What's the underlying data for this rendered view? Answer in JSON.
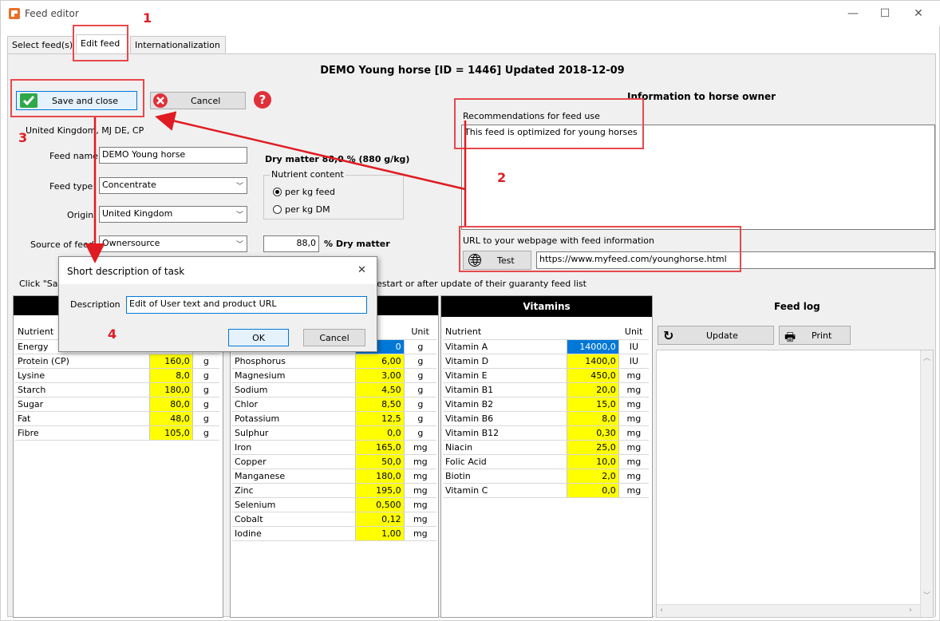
{
  "window": {
    "title": "Feed editor",
    "minimize": "—",
    "maximize": "☐",
    "close": "✕"
  },
  "tabs": [
    {
      "label": "Select feed(s)"
    },
    {
      "label": "Edit feed"
    },
    {
      "label": "Internationalization"
    }
  ],
  "header": {
    "title": "DEMO Young horse [ID = 1446] Updated 2018-12-09"
  },
  "toolbar": {
    "save_label": "Save and close",
    "cancel_label": "Cancel",
    "help_glyph": "?"
  },
  "form": {
    "region_text": "United Kingdom, MJ DE, CP",
    "feed_name_label": "Feed name",
    "feed_name_value": "DEMO Young horse",
    "feed_type_label": "Feed type",
    "feed_type_value": "Concentrate",
    "origin_label": "Origin",
    "origin_value": "United Kingdom",
    "source_label": "Source of feed",
    "source_value": "Ownersource",
    "dry_matter_heading": "Dry matter 88,0 %  (880 g/kg)",
    "nutrient_content_label": "Nutrient content",
    "per_kg_feed": "per kg feed",
    "per_kg_dm": "per kg DM",
    "dm_value": "88,0",
    "dm_unit": "% Dry matter",
    "info_prefix": "Click \"Sav",
    "info_suffix": "estart or after update of their guaranty feed list"
  },
  "owner_info": {
    "heading": "Information to horse owner",
    "recommend_label": "Recommendations for feed use",
    "recommend_text": "This feed is optimized for young horses",
    "url_label": "URL to your webpage with feed information",
    "test_label": "Test",
    "url_value": "https://www.myfeed.com/younghorse.html"
  },
  "basic": {
    "header_nutrient": "Nutrient",
    "rows": [
      {
        "n": "Energy",
        "v": "",
        "u": ""
      },
      {
        "n": "Protein (CP)",
        "v": "160,0",
        "u": "g"
      },
      {
        "n": "Lysine",
        "v": "8,0",
        "u": "g"
      },
      {
        "n": "Starch",
        "v": "180,0",
        "u": "g"
      },
      {
        "n": "Sugar",
        "v": "80,0",
        "u": "g"
      },
      {
        "n": "Fat",
        "v": "48,0",
        "u": "g"
      },
      {
        "n": "Fibre",
        "v": "105,0",
        "u": "g"
      }
    ]
  },
  "minerals": {
    "header_unit": "Unit",
    "first_unit": "g",
    "first_value": "0",
    "rows": [
      {
        "n": "Phosphorus",
        "v": "6,00",
        "u": "g"
      },
      {
        "n": "Magnesium",
        "v": "3,00",
        "u": "g"
      },
      {
        "n": "Sodium",
        "v": "4,50",
        "u": "g"
      },
      {
        "n": "Chlor",
        "v": "8,50",
        "u": "g"
      },
      {
        "n": "Potassium",
        "v": "12,5",
        "u": "g"
      },
      {
        "n": "Sulphur",
        "v": "0,0",
        "u": "g"
      },
      {
        "n": "Iron",
        "v": "165,0",
        "u": "mg"
      },
      {
        "n": "Copper",
        "v": "50,0",
        "u": "mg"
      },
      {
        "n": "Manganese",
        "v": "180,0",
        "u": "mg"
      },
      {
        "n": "Zinc",
        "v": "195,0",
        "u": "mg"
      },
      {
        "n": "Selenium",
        "v": "0,500",
        "u": "mg"
      },
      {
        "n": "Cobalt",
        "v": "0,12",
        "u": "mg"
      },
      {
        "n": "Iodine",
        "v": "1,00",
        "u": "mg"
      }
    ]
  },
  "vitamins": {
    "title": "Vitamins",
    "header_nutrient": "Nutrient",
    "header_unit": "Unit",
    "rows": [
      {
        "n": "Vitamin A",
        "v": "14000,0",
        "u": "IU"
      },
      {
        "n": "Vitamin D",
        "v": "1400,0",
        "u": "IU"
      },
      {
        "n": "Vitamin E",
        "v": "450,0",
        "u": "mg"
      },
      {
        "n": "Vitamin B1",
        "v": "20,0",
        "u": "mg"
      },
      {
        "n": "Vitamin B2",
        "v": "15,0",
        "u": "mg"
      },
      {
        "n": "Vitamin B6",
        "v": "8,0",
        "u": "mg"
      },
      {
        "n": "Vitamin B12",
        "v": "0,30",
        "u": "mg"
      },
      {
        "n": "Niacin",
        "v": "25,0",
        "u": "mg"
      },
      {
        "n": "Folic Acid",
        "v": "10,0",
        "u": "mg"
      },
      {
        "n": "Biotin",
        "v": "2,0",
        "u": "mg"
      },
      {
        "n": "Vitamin C",
        "v": "0,0",
        "u": "mg"
      }
    ]
  },
  "feed_log": {
    "title": "Feed log",
    "update_label": "Update",
    "print_label": "Print"
  },
  "dialog": {
    "title": "Short description of task",
    "close": "✕",
    "description_label": "Description",
    "description_value": "Edit of User text and product URL",
    "ok_label": "OK",
    "cancel_label": "Cancel"
  },
  "annotations": {
    "n1": "1",
    "n2": "2",
    "n3": "3",
    "n4": "4"
  },
  "colors": {
    "annotation_red": "#e01b22",
    "value_yellow": "#ffff00",
    "selected_blue": "#0078d7"
  }
}
